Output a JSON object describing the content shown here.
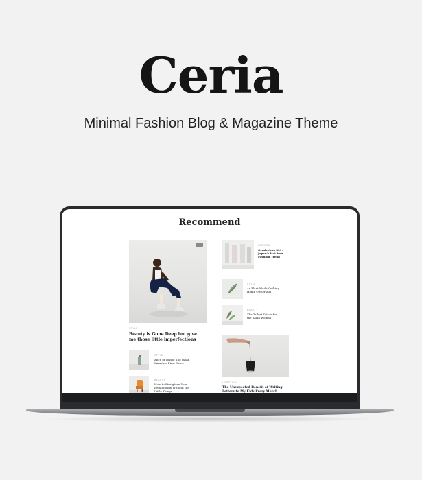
{
  "hero": {
    "title": "Ceria",
    "subtitle": "Minimal Fashion Blog & Magazine Theme"
  },
  "section": {
    "title": "Recommend"
  },
  "featured": {
    "category": "Style",
    "title": "Beauty is Gone Deep but give me those little imperfections"
  },
  "left_posts": [
    {
      "category": "Style",
      "title": "Alice of Tokyo: The Japan Sample a First Dates"
    },
    {
      "category": "Beauty",
      "title": "How to Straighten Your Relationship Without the Little Things"
    }
  ],
  "right_posts": [
    {
      "category": "Fashion",
      "title": "Genderless Kei – Japan's Hot New Fashion Trend"
    },
    {
      "category": "Style",
      "title": "As Plant Made Quilting Home Ownership"
    },
    {
      "category": "Beauty",
      "title": "The Tallest Tattoo for the Asian Woman"
    }
  ],
  "big_right_post": {
    "category": "Lifestyle",
    "title": "The Unexpected Benefit of Writing Letters to My Kids Every Month"
  },
  "colors": {
    "page_background": "#f2f2f2",
    "laptop_frame": "#2a2b2e",
    "title_text": "#151515"
  }
}
